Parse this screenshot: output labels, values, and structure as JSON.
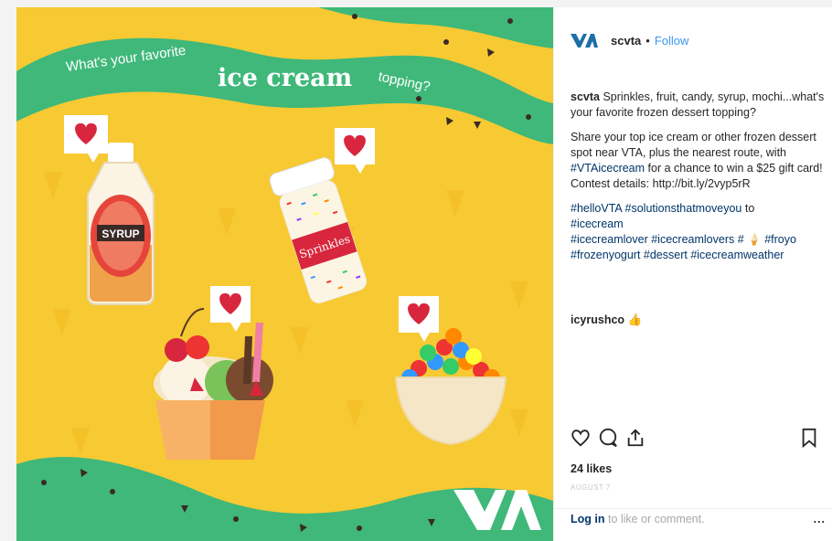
{
  "post": {
    "image": {
      "headline_prefix": "What's your favorite",
      "headline_emphasis": "ice cream",
      "headline_suffix": "topping?",
      "syrup_label": "SYRUP",
      "sprinkles_label": "Sprinkles",
      "brand_logo": "VTA",
      "colors": {
        "background": "#f7c933",
        "wave": "#3fb87a",
        "heart": "#d7263d"
      }
    },
    "header": {
      "username": "scvta",
      "separator": "•",
      "follow_label": "Follow"
    },
    "caption": {
      "author": "scvta",
      "line1": "Sprinkles, fruit, candy, syrup, mochi...what's your favorite frozen dessert topping?",
      "paragraph2_a": "Share your top ice cream or other frozen dessert spot near VTA, plus the nearest route, with",
      "paragraph2_tag": "#VTAicecream",
      "paragraph2_b": "for a chance to win a $25 gift card! Contest details: http://bit.ly/2vyp5rR",
      "tags_line1": "#helloVTA #solutionsthatmoveyou",
      "tags_to": "to",
      "tags_line2": "#icecream",
      "tags_line3": "#icecreamlover #icecreamlovers #",
      "tags_emoji": "🍦",
      "tags_line3b": "#froyo",
      "tags_line4": "#frozenyogurt #dessert #icecreamweather"
    },
    "comment": {
      "author": "icyrushco",
      "emoji": "👍"
    },
    "actions": {
      "icons": [
        "heart-icon",
        "comment-icon",
        "share-icon",
        "bookmark-icon"
      ]
    },
    "likes": "24 likes",
    "date": "AUGUST 7",
    "footer": {
      "login_label": "Log in",
      "rest": "to like or comment.",
      "more": "..."
    }
  }
}
